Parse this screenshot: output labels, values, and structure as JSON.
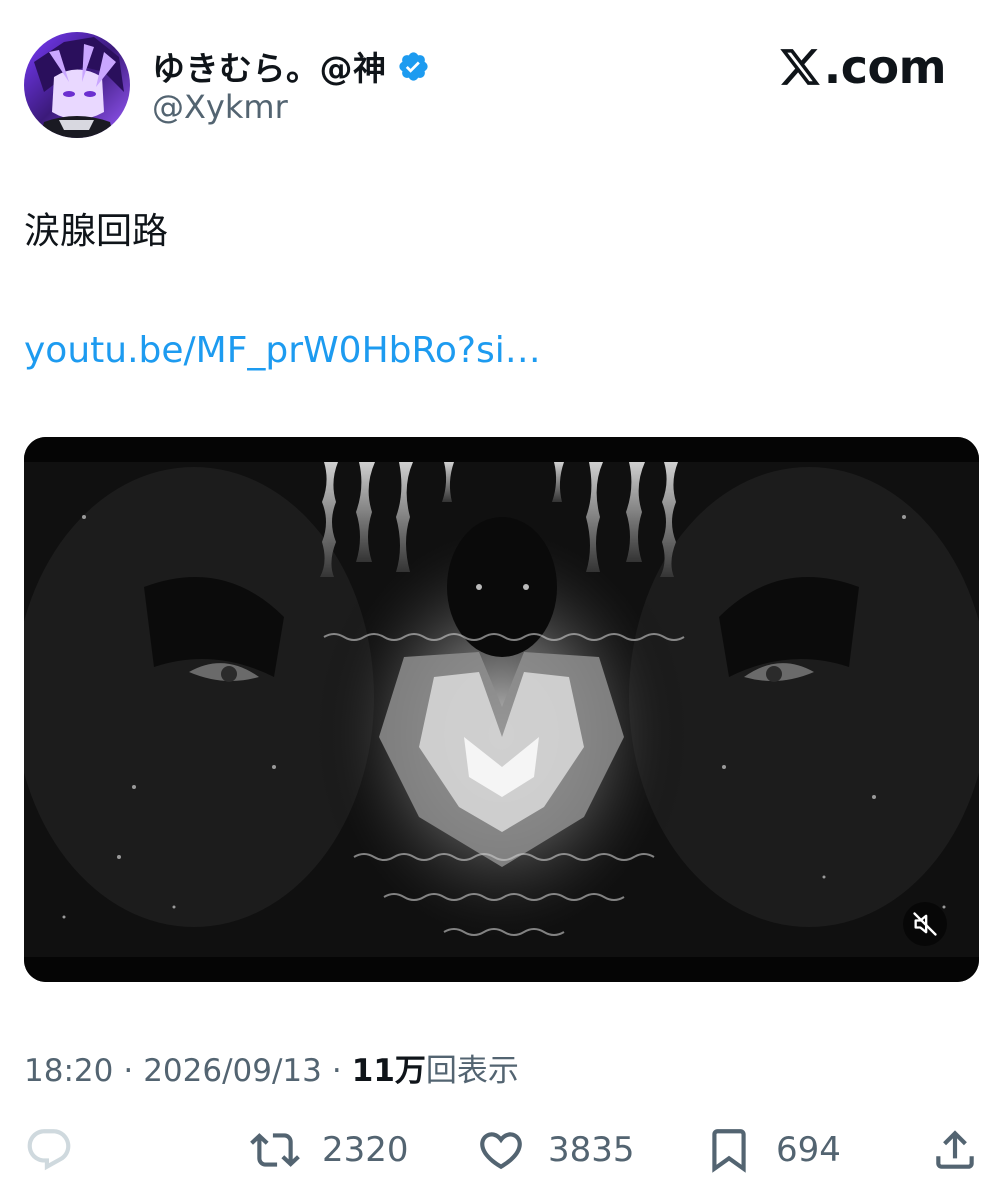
{
  "author": {
    "display_name": "ゆきむら。@神",
    "handle": "@Xykmr",
    "verified": true
  },
  "brand": {
    "logo_text": ".com",
    "logo_icon": "x-logo-icon"
  },
  "tweet": {
    "text": "涙腺回路",
    "link_text": "youtu.be/MF_prW0HbRo?si…"
  },
  "media": {
    "type": "video",
    "muted_icon": "muted-speaker-icon"
  },
  "meta": {
    "time": "18:20",
    "separator": "·",
    "date": "2026/09/13",
    "views_count": "11万",
    "views_label": "回表示"
  },
  "actions": {
    "reply": {
      "icon": "reply-icon",
      "count": ""
    },
    "retweet": {
      "icon": "retweet-icon",
      "count": "2320"
    },
    "like": {
      "icon": "heart-icon",
      "count": "3835"
    },
    "bookmark": {
      "icon": "bookmark-icon",
      "count": "694"
    },
    "share": {
      "icon": "share-icon"
    }
  },
  "colors": {
    "link": "#1d9bf0",
    "verified": "#1d9bf0",
    "secondary_text": "#536471",
    "primary_text": "#0f1419"
  }
}
